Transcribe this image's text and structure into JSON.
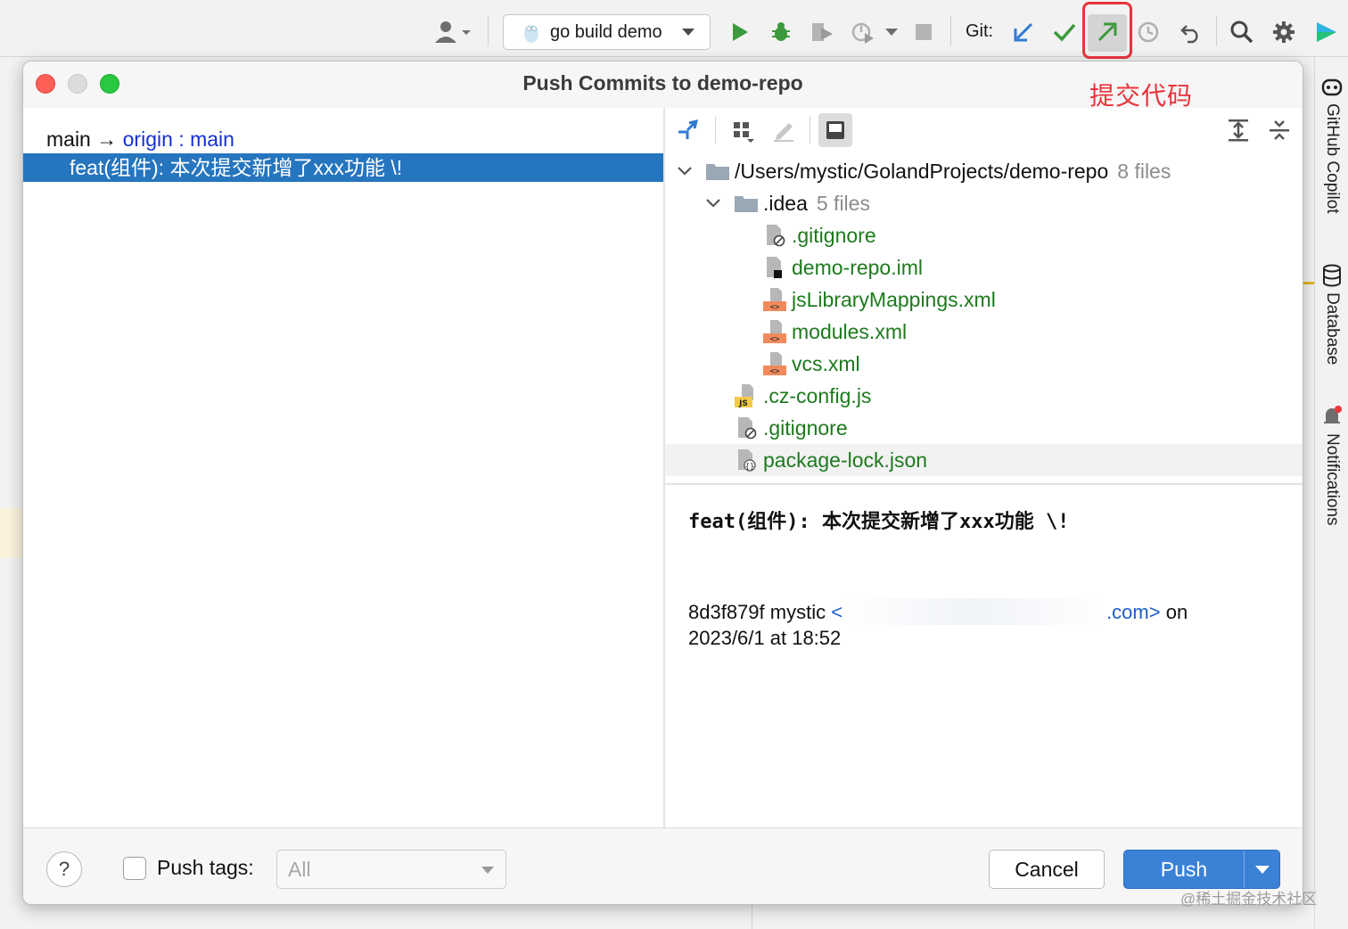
{
  "toolbar": {
    "run_config": "go build demo",
    "git_label": "Git:",
    "icons": [
      "user-icon",
      "run-icon",
      "debug-icon",
      "coverage-icon",
      "profile-icon",
      "stop-icon",
      "update-project-icon",
      "commit-icon",
      "push-icon",
      "history-icon",
      "rollback-icon",
      "search-icon",
      "settings-icon",
      "ide-logo-icon"
    ]
  },
  "annotation": "提交代码",
  "dialog": {
    "title": "Push Commits to demo-repo",
    "branch": {
      "local": "main",
      "arrow": "→",
      "remote": "origin",
      "separator": ":",
      "remote_branch": "main"
    },
    "commit_row": "feat(组件): 本次提交新增了xxx功能 \\!",
    "tree": {
      "root": {
        "name": "/Users/mystic/GolandProjects/demo-repo",
        "count": "8 files"
      },
      "idea_folder": {
        "name": ".idea",
        "count": "5 files"
      },
      "idea_files": [
        ".gitignore",
        "demo-repo.iml",
        "jsLibraryMappings.xml",
        "modules.xml",
        "vcs.xml"
      ],
      "root_files": [
        ".cz-config.js",
        ".gitignore",
        "package-lock.json"
      ]
    },
    "details": {
      "message": "feat(组件): 本次提交新增了xxx功能 \\!",
      "hash_author": "8d3f879f mystic",
      "email_open": "<",
      "email_tail": ".com>",
      "on": "on",
      "date": "2023/6/1 at 18:52"
    },
    "footer": {
      "help": "?",
      "push_tags_label": "Push tags:",
      "push_tags_value": "All",
      "cancel": "Cancel",
      "push": "Push"
    }
  },
  "right_strip": [
    "GitHub Copilot",
    "Database",
    "Notifications"
  ],
  "watermark": "@稀土掘金技术社区",
  "colors": {
    "selection": "#2675bf",
    "link": "#1431d6",
    "added_file": "#1d7a1d",
    "push_button": "#3b82d6",
    "annotation": "#e8353b"
  }
}
